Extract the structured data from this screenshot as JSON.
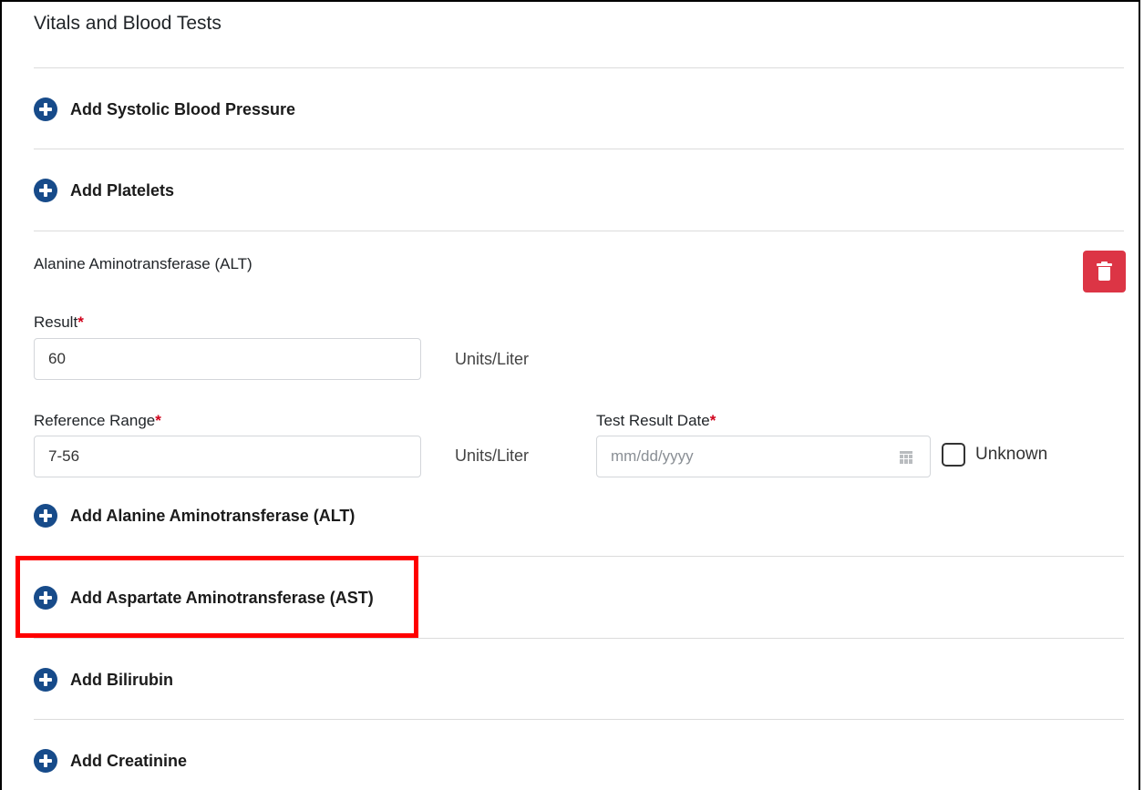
{
  "section": {
    "title": "Vitals and Blood Tests"
  },
  "add_items": {
    "systolic": "Add Systolic Blood Pressure",
    "platelets": "Add Platelets",
    "alt": "Add Alanine Aminotransferase (ALT)",
    "ast": "Add Aspartate Aminotransferase (AST)",
    "bilirubin": "Add Bilirubin",
    "creatinine": "Add Creatinine"
  },
  "alt_entry": {
    "title": "Alanine Aminotransferase (ALT)",
    "result_label": "Result",
    "result_value": "60",
    "result_unit": "Units/Liter",
    "reference_label": "Reference Range",
    "reference_value": "7-56",
    "reference_unit": "Units/Liter",
    "date_label": "Test Result Date",
    "date_placeholder": "mm/dd/yyyy",
    "unknown_label": "Unknown",
    "required_mark": "*"
  },
  "icons": {
    "add": "plus-circle-icon",
    "delete": "trash-icon",
    "date": "calendar-icon"
  },
  "colors": {
    "accent": "#174b8a",
    "danger": "#dc3545",
    "required": "#d0021b",
    "highlight": "#ff0000"
  }
}
